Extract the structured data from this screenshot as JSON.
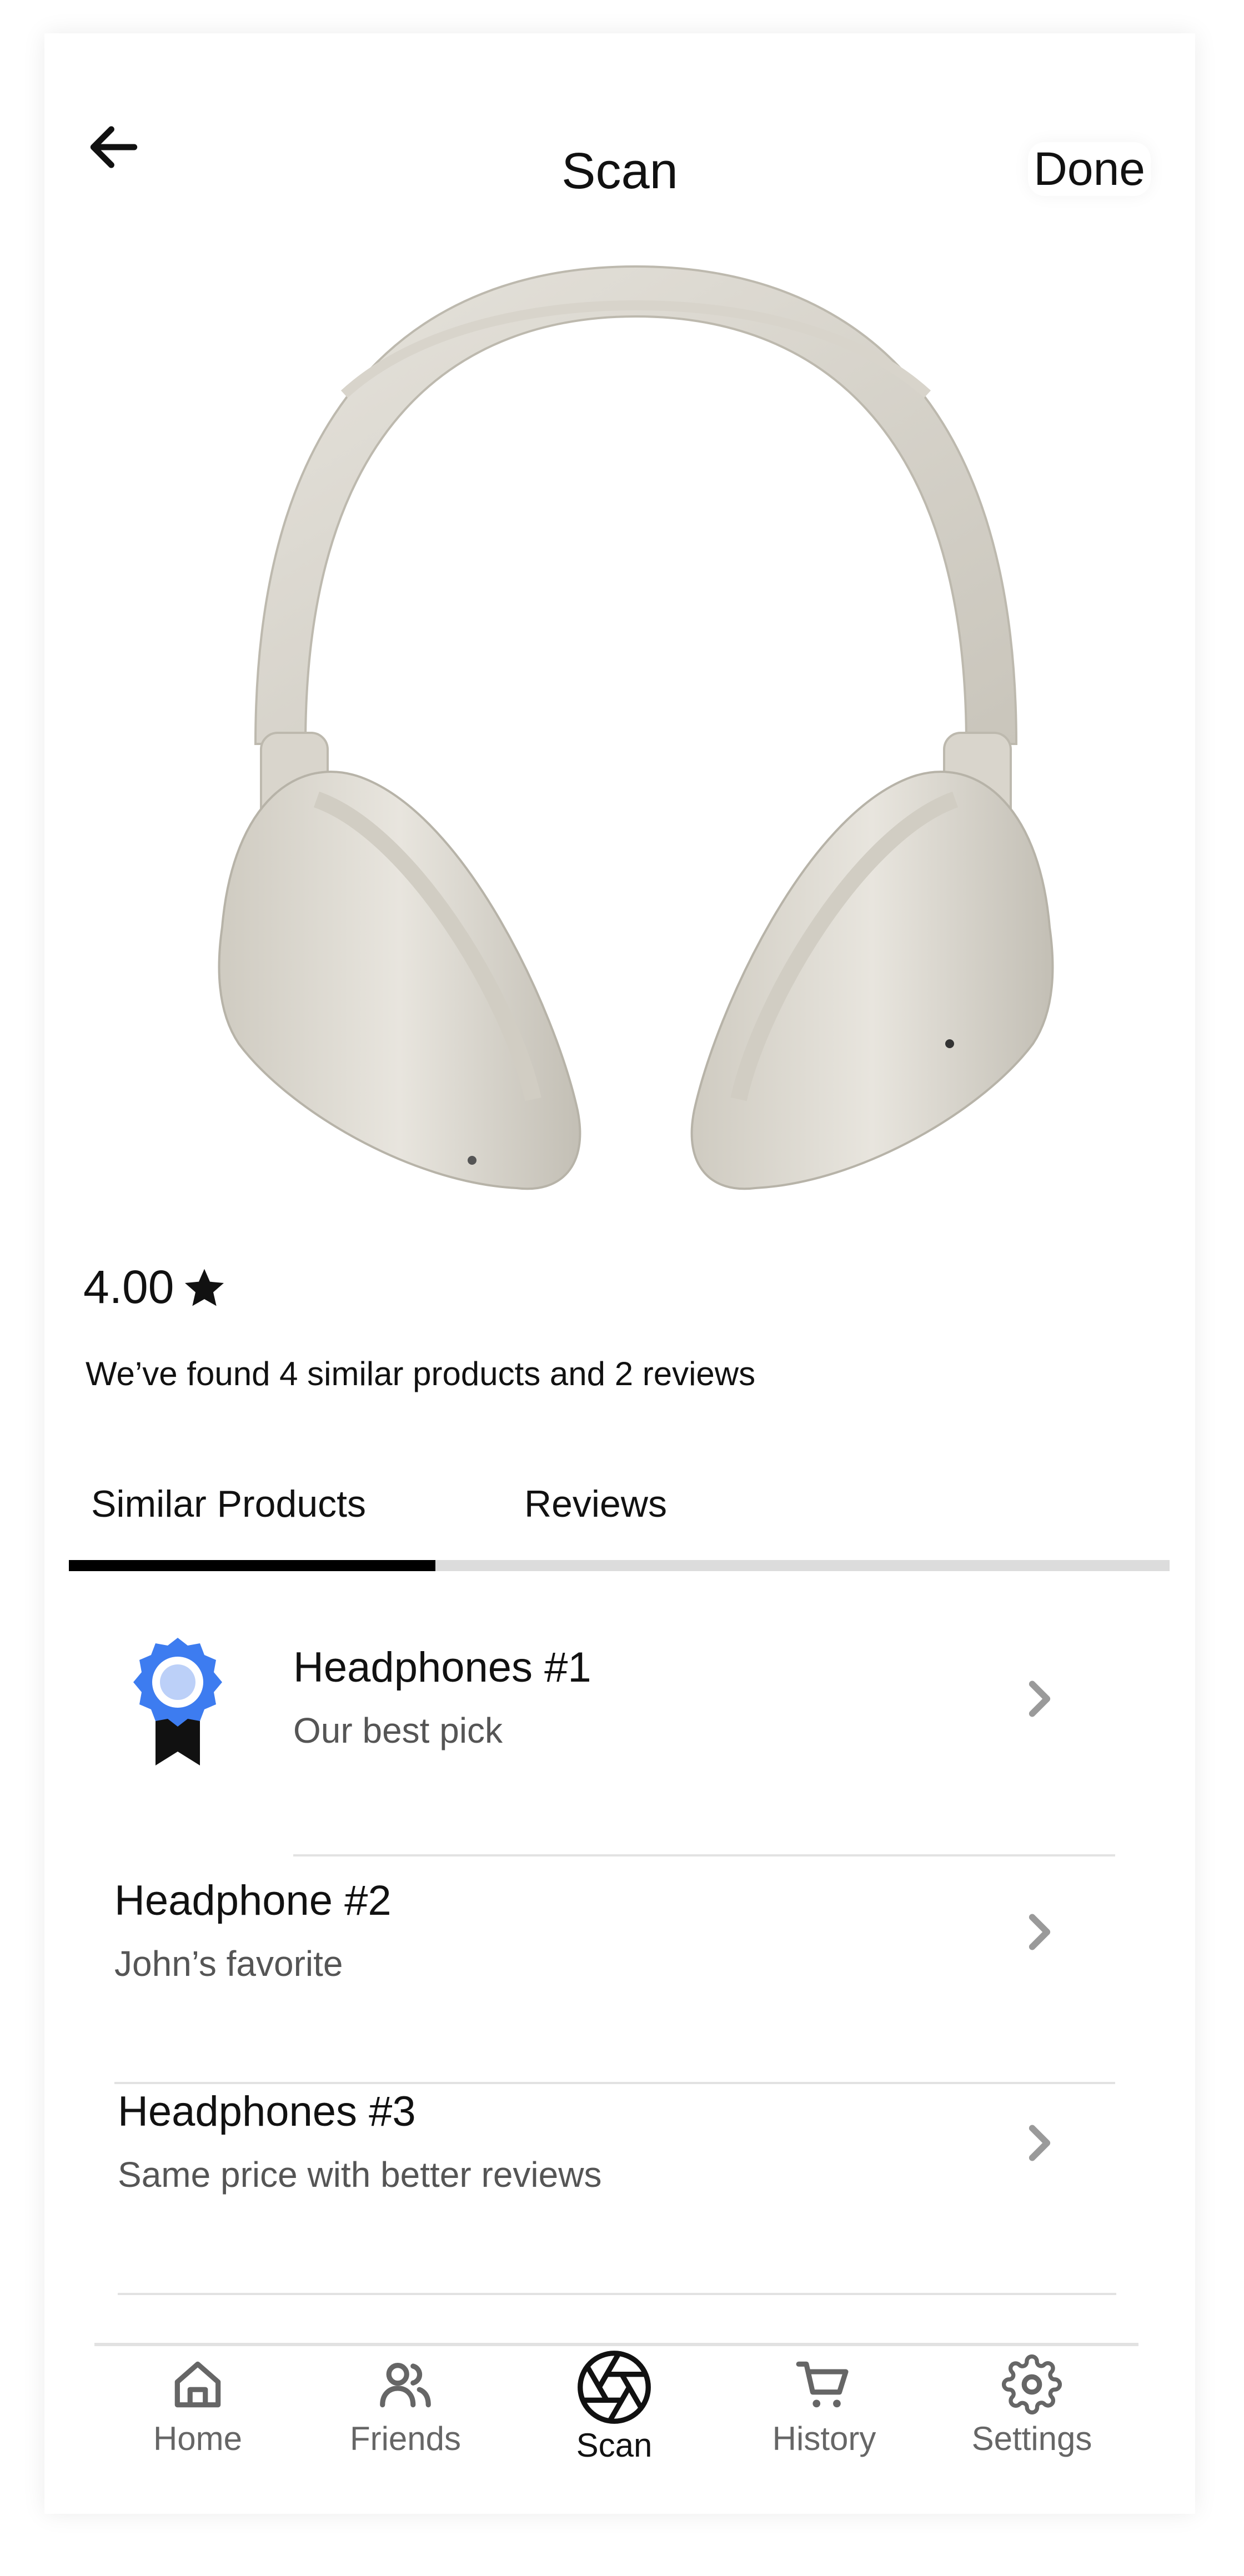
{
  "header": {
    "title": "Scan",
    "done_label": "Done"
  },
  "product": {
    "rating": "4.00",
    "summary": "We’ve found 4 similar products and 2 reviews"
  },
  "tabs": [
    {
      "label": "Similar Products",
      "active": true
    },
    {
      "label": "Reviews",
      "active": false
    }
  ],
  "list": [
    {
      "title": "Headphones #1",
      "subtitle": "Our best pick",
      "badge": "award-ribbon-icon"
    },
    {
      "title": "Headphone #2",
      "subtitle": "John’s favorite"
    },
    {
      "title": "Headphones #3",
      "subtitle": "Same price with better reviews"
    }
  ],
  "nav": [
    {
      "label": "Home",
      "icon": "home-icon"
    },
    {
      "label": "Friends",
      "icon": "friends-icon"
    },
    {
      "label": "Scan",
      "icon": "camera-aperture-icon",
      "active": true
    },
    {
      "label": "History",
      "icon": "cart-icon"
    },
    {
      "label": "Settings",
      "icon": "gear-icon"
    }
  ],
  "colors": {
    "badge_blue": "#3d7cf0",
    "badge_inner": "#bcd0f8",
    "text_primary": "#111111",
    "text_secondary": "#555555"
  }
}
